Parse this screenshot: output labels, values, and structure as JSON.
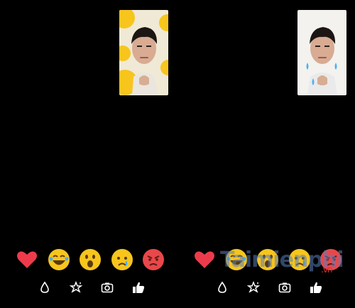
{
  "panels": [
    {
      "id": "left",
      "reactions": [
        "heart",
        "laughing-tears",
        "surprised",
        "crying",
        "angry"
      ],
      "tools": [
        "water-drop-icon",
        "effects-star-icon",
        "camera-icon",
        "thumbs-up-icon"
      ]
    },
    {
      "id": "right",
      "reactions": [
        "heart",
        "laughing-tears",
        "surprised",
        "crying",
        "angry"
      ],
      "tools": [
        "water-drop-icon",
        "effects-star-icon",
        "camera-icon",
        "thumbs-up-icon"
      ]
    }
  ],
  "watermark": {
    "text": "Taimienphi",
    "suffix": ".vn"
  },
  "colors": {
    "background": "#000000",
    "heart": "#ee3b4b",
    "emoji": "#f7c51c",
    "angry": "#e8474b",
    "icon": "#ffffff"
  }
}
